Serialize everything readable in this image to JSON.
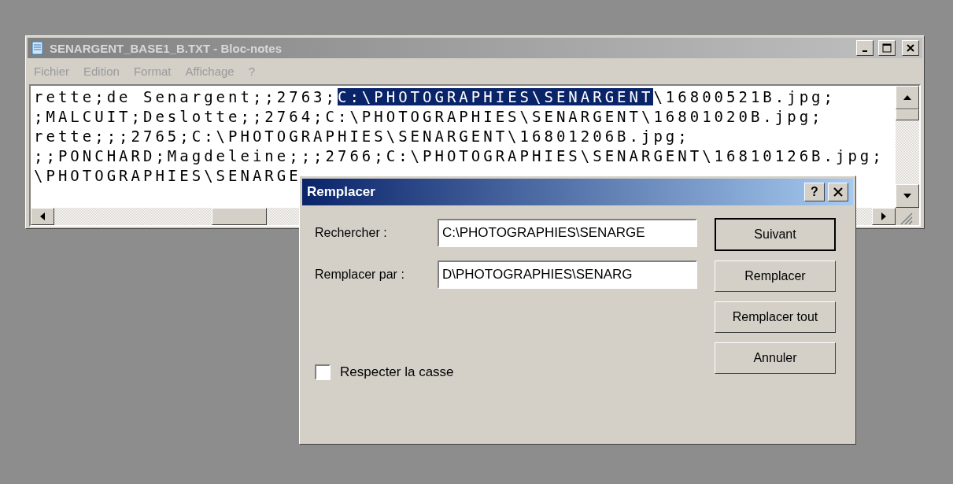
{
  "notepad": {
    "title": "SENARGENT_BASE1_B.TXT - Bloc-notes",
    "menu": [
      "Fichier",
      "Edition",
      "Format",
      "Affichage",
      "?"
    ],
    "lines": [
      {
        "segments": [
          {
            "text": "rette;de Senargent;;2763;",
            "selected": false
          },
          {
            "text": "C:\\PHOTOGRAPHIES\\SENARGENT",
            "selected": true
          },
          {
            "text": "\\16800521B.jpg;",
            "selected": false
          }
        ]
      },
      {
        "segments": [
          {
            "text": ";MALCUIT;Deslotte;;2764;C:\\PHOTOGRAPHIES\\SENARGENT\\16801020B.jpg;",
            "selected": false
          }
        ]
      },
      {
        "segments": [
          {
            "text": "rette;;;2765;C:\\PHOTOGRAPHIES\\SENARGENT\\16801206B.jpg;",
            "selected": false
          }
        ]
      },
      {
        "segments": [
          {
            "text": ";;PONCHARD;Magdeleine;;;2766;C:\\PHOTOGRAPHIES\\SENARGENT\\16810126B.jpg;",
            "selected": false
          }
        ]
      },
      {
        "segments": [
          {
            "text": "\\PHOTOGRAPHIES\\SENARGE",
            "selected": false
          }
        ]
      }
    ]
  },
  "dialog": {
    "title": "Remplacer",
    "help": "?",
    "fields": [
      {
        "label": "Rechercher :",
        "value": "C:\\PHOTOGRAPHIES\\SENARGE"
      },
      {
        "label": "Remplacer par :",
        "value": "D\\PHOTOGRAPHIES\\SENARG"
      }
    ],
    "buttons": [
      {
        "label": "Suivant",
        "default": true
      },
      {
        "label": "Remplacer",
        "default": false
      },
      {
        "label": "Remplacer tout",
        "default": false
      },
      {
        "label": "Annuler",
        "default": false
      }
    ],
    "checkbox": {
      "label": "Respecter la casse",
      "checked": false
    }
  }
}
